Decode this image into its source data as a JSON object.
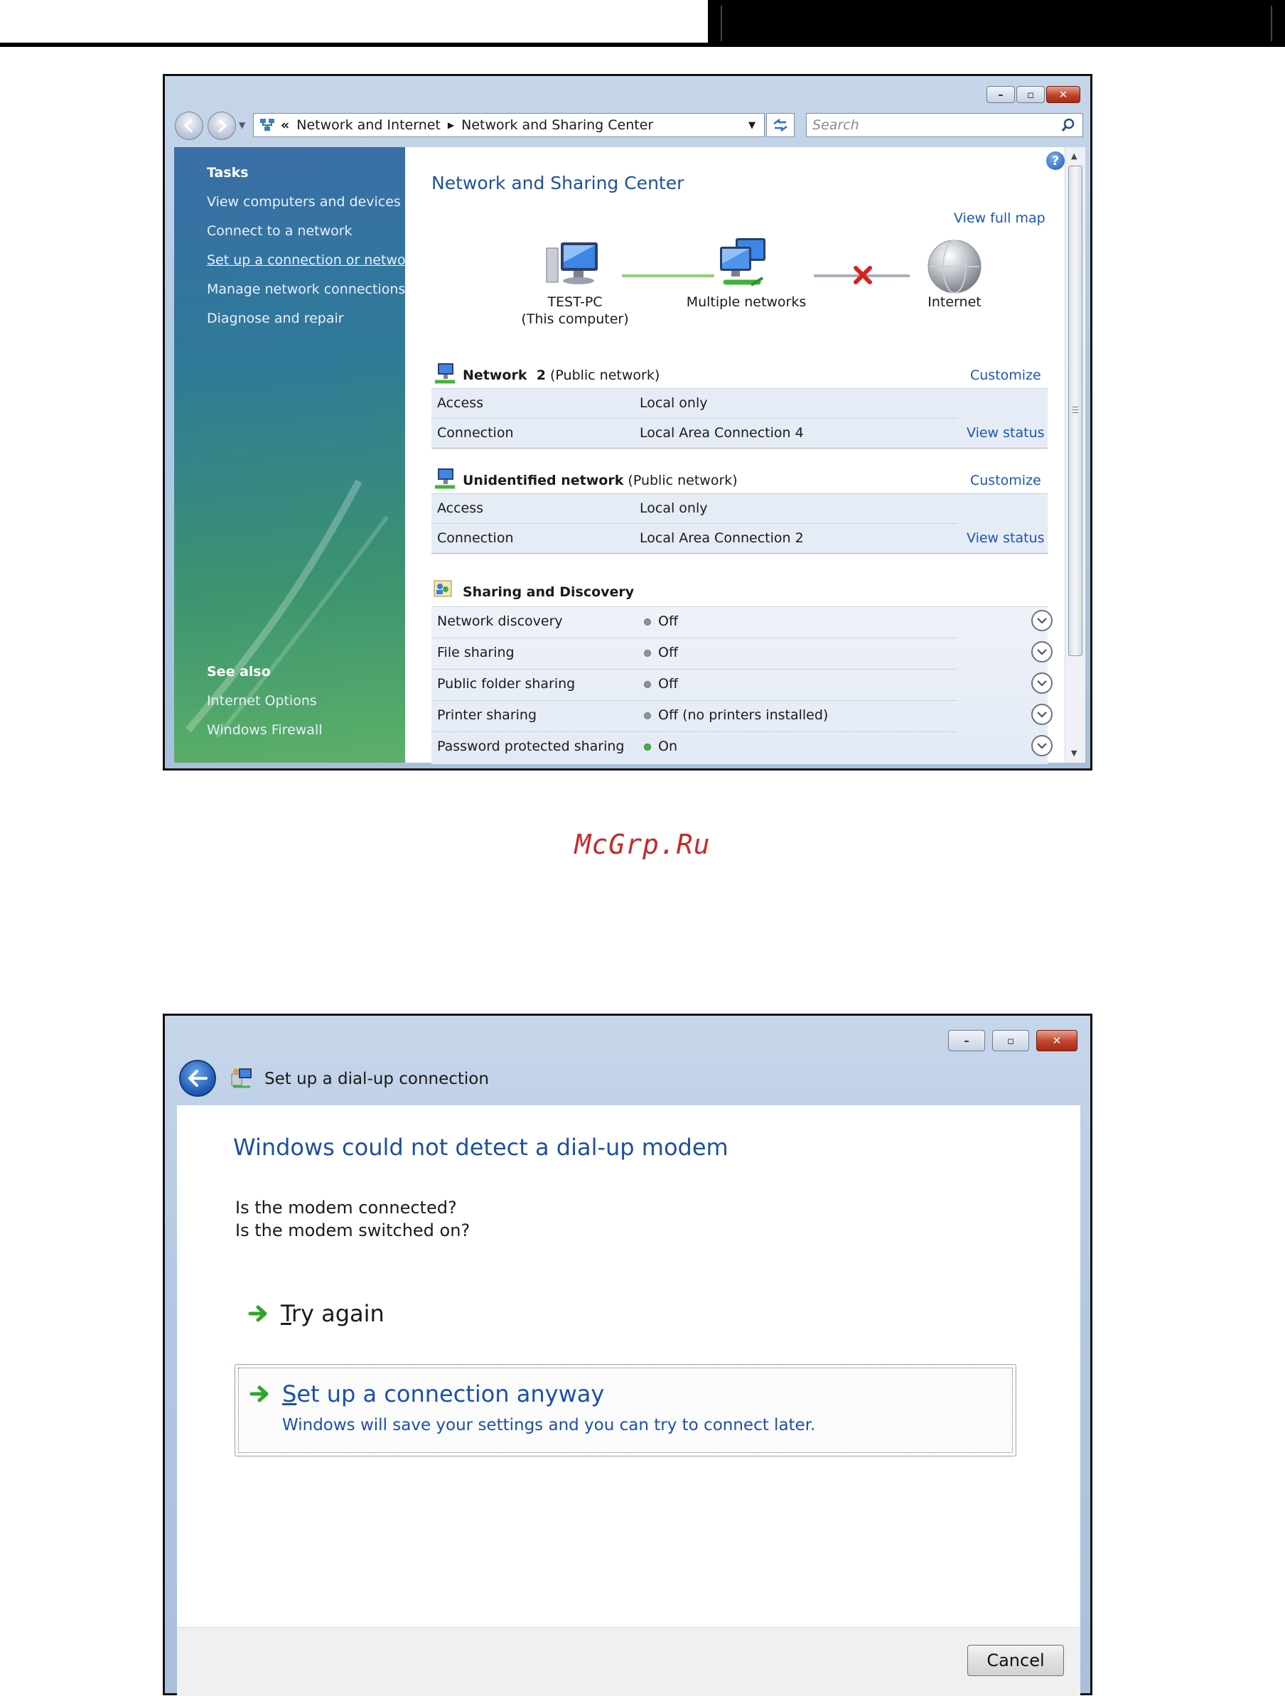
{
  "watermark": "McGrp.Ru",
  "nsc": {
    "address": {
      "chevrons": "«",
      "crumb1": "Network and Internet",
      "crumb2": "Network and Sharing Center",
      "search_placeholder": "Search"
    },
    "tasks": {
      "heading": "Tasks",
      "items": [
        "View computers and devices",
        "Connect to a network",
        "Set up a connection or network",
        "Manage network connections",
        "Diagnose and repair"
      ]
    },
    "see_also": {
      "heading": "See also",
      "items": [
        "Internet Options",
        "Windows Firewall"
      ]
    },
    "title": "Network and Sharing Center",
    "view_full_map": "View full map",
    "map": {
      "computer_name": "TEST-PC",
      "computer_sub": "(This computer)",
      "middle": "Multiple networks",
      "internet": "Internet"
    },
    "networks": [
      {
        "name": "Network  2",
        "type": "(Public network)",
        "customize": "Customize",
        "access_label": "Access",
        "access_value": "Local only",
        "connection_label": "Connection",
        "connection_value": "Local Area Connection 4",
        "view_status": "View status"
      },
      {
        "name": "Unidentified network",
        "type": "(Public network)",
        "customize": "Customize",
        "access_label": "Access",
        "access_value": "Local only",
        "connection_label": "Connection",
        "connection_value": "Local Area Connection 2",
        "view_status": "View status"
      }
    ],
    "sharing": {
      "heading": "Sharing and Discovery",
      "rows": [
        {
          "label": "Network discovery",
          "value": "Off",
          "on": false
        },
        {
          "label": "File sharing",
          "value": "Off",
          "on": false
        },
        {
          "label": "Public folder sharing",
          "value": "Off",
          "on": false
        },
        {
          "label": "Printer sharing",
          "value": "Off (no printers installed)",
          "on": false
        },
        {
          "label": "Password protected sharing",
          "value": "On",
          "on": true
        }
      ]
    }
  },
  "dialup": {
    "window_title": "Set up a dial-up connection",
    "heading": "Windows could not detect a dial-up modem",
    "question1": "Is the modem connected?",
    "question2": "Is the modem switched on?",
    "try_again_mnemonic": "T",
    "try_again_rest": "ry again",
    "setup_mnemonic": "S",
    "setup_rest": "et up a connection anyway",
    "setup_desc": "Windows will save your settings and you can try to connect later.",
    "cancel": "Cancel"
  },
  "colors": {
    "link_blue": "#1c55b4",
    "title_blue": "#1e4fa0",
    "status_on": "#3fb63c",
    "status_off": "#8d949d",
    "disconnect_x": "#d82020",
    "watermark": "#c8282a"
  }
}
